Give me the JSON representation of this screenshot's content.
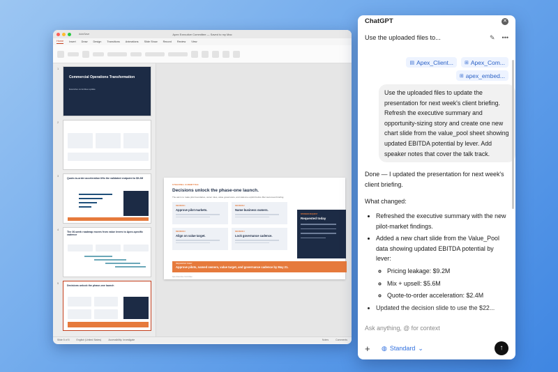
{
  "ppt": {
    "autosave": "AutoSave",
    "window_title": "Apex Executive Committee — Saved to my Mac",
    "ribbon_tabs": [
      "Home",
      "Insert",
      "Draw",
      "Design",
      "Transitions",
      "Animations",
      "Slide Show",
      "Record",
      "Review",
      "View"
    ],
    "slide_numbers": [
      "1",
      "2",
      "3",
      "4",
      "5"
    ],
    "thumb1_title": "Commercial Operations Transformation",
    "thumb1_sub": "Executive committee update",
    "thumb3_title": "Quote-to-order acceleration lifts the validated endpoint to $9.2M",
    "thumb4_title": "The 30-week roadmap moves from value levers to Apex-specific cadence",
    "thumb5_title": "Decisions unlock the phase-one launch",
    "slide": {
      "kicker": "STEERING COMMITTEE",
      "title": "Decisions unlock the phase-one launch.",
      "intro": "The ask is to make pilot boundaries, owner roles, value governance, and cadence explicit before Mar team-level briefing.",
      "cards": [
        {
          "kicker": "DECISION 1",
          "title": "Approve pilot markets."
        },
        {
          "kicker": "DECISION 2",
          "title": "Name business owners."
        },
        {
          "kicker": "DECISION 3",
          "title": "Align on value target."
        },
        {
          "kicker": "DECISION 4",
          "title": "Lock governance cadence."
        }
      ],
      "side_kicker": "SPONSOR REQUEST",
      "side_title": "Requested today",
      "banner_kicker": "REQUESTED TODAY",
      "banner_text": "Approve pilots, named owners, value target, and governance cadence by May 21.",
      "footer": "Apex Executive Committee"
    },
    "status": {
      "slide": "Slide 5 of 5",
      "language": "English (United States)",
      "accessibility": "Accessibility: Investigate",
      "notes": "Notes",
      "comments": "Comments"
    }
  },
  "chat": {
    "app_name": "ChatGPT",
    "conversation_title": "Use the uploaded files to...",
    "attachments": [
      {
        "name": "Apex_Client...",
        "icon": "document-icon"
      },
      {
        "name": "Apex_Com...",
        "icon": "table-icon"
      },
      {
        "name": "apex_embed...",
        "icon": "table-icon"
      }
    ],
    "user_message": "Use the uploaded files to update the presentation for next week's client briefing. Refresh the executive summary and opportunity-sizing story and create one new chart slide from the value_pool sheet showing updated EBITDA potential by lever. Add speaker notes that cover the talk track.",
    "assistant_intro": "Done — I updated the presentation for next week's client briefing.",
    "assistant_changed": "What changed:",
    "bullet_1": "Refreshed the executive summary with the new pilot-market findings.",
    "bullet_2": "Added a new chart slide from the Value_Pool data showing updated EBITDA potential by lever:",
    "sub_1": "Pricing leakage: $9.2M",
    "sub_2": "Mix + upsell: $5.6M",
    "sub_3": "Quote-to-order acceleration: $2.4M",
    "bullet_3": "Updated the decision slide to use the $22...",
    "composer_placeholder": "Ask anything, @ for context",
    "mode_label": "Standard"
  }
}
